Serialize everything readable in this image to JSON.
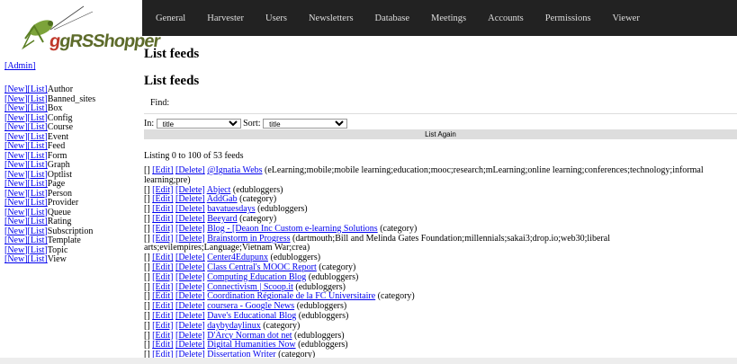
{
  "logo_text": "gRSShopper",
  "admin_label": "[Admin]",
  "sidebar": {
    "new_label": "[New]",
    "list_label": "[List]",
    "items": [
      "Author",
      "Banned_sites",
      "Box",
      "Config",
      "Course",
      "Event",
      "Feed",
      "Form",
      "Graph",
      "Optlist",
      "Page",
      "Person",
      "Provider",
      "Queue",
      "Rating",
      "Subscription",
      "Template",
      "Topic",
      "View"
    ]
  },
  "nav": [
    "General",
    "Harvester",
    "Users",
    "Newsletters",
    "Database",
    "Meetings",
    "Accounts",
    "Permissions",
    "Viewer"
  ],
  "main": {
    "title1": "List feeds",
    "title2": "List feeds",
    "find_label": "Find:",
    "in_label": "In:",
    "in_value": "title",
    "sort_label": "Sort:",
    "sort_value": "title",
    "list_again": "List Again",
    "listing": "Listing 0 to 100 of 53 feeds"
  },
  "row_actions": {
    "bracket": "[]",
    "edit": "[Edit]",
    "delete": "[Delete]"
  },
  "feeds": [
    {
      "name": "@Ignatia Webs",
      "detail": "(eLearning;mobile;mobile learning;education;mooc;research;mLearning;online learning;conferences;technology;informal learning;pre)"
    },
    {
      "name": "Abject",
      "detail": "(edubloggers)"
    },
    {
      "name": "AddGab",
      "detail": "(category)"
    },
    {
      "name": "bavatuesdays",
      "detail": "(edubloggers)"
    },
    {
      "name": "Beeyard",
      "detail": "(category)"
    },
    {
      "name": "Blog - [Deaon Inc Custom e-learning Solutions",
      "detail": "(category)"
    },
    {
      "name": "Brainstorm in Progress",
      "detail": "(dartmouth;Bill and Melinda Gates Foundation;millennials;sakai3;drop.io;web30;liberal arts;evilempires;Language;Vietnam War;crea)"
    },
    {
      "name": "Center4Edupunx",
      "detail": "(edubloggers)"
    },
    {
      "name": "Class Central's MOOC Report",
      "detail": "(category)"
    },
    {
      "name": "Computing Education Blog",
      "detail": "(edubloggers)"
    },
    {
      "name": "Connectivism | Scoop.it",
      "detail": "(edubloggers)"
    },
    {
      "name": "Coordination Régionale de la FC Universitaire",
      "detail": "(category)"
    },
    {
      "name": "coursera - Google News",
      "detail": "(edubloggers)"
    },
    {
      "name": "Dave's Educational Blog",
      "detail": "(edubloggers)"
    },
    {
      "name": "daybydaylinux",
      "detail": "(category)"
    },
    {
      "name": "D'Arcy Norman dot net",
      "detail": "(edubloggers)"
    },
    {
      "name": "Digital Humanities Now",
      "detail": "(edubloggers)"
    },
    {
      "name": "Dissertation Writer",
      "detail": "(category)"
    }
  ]
}
